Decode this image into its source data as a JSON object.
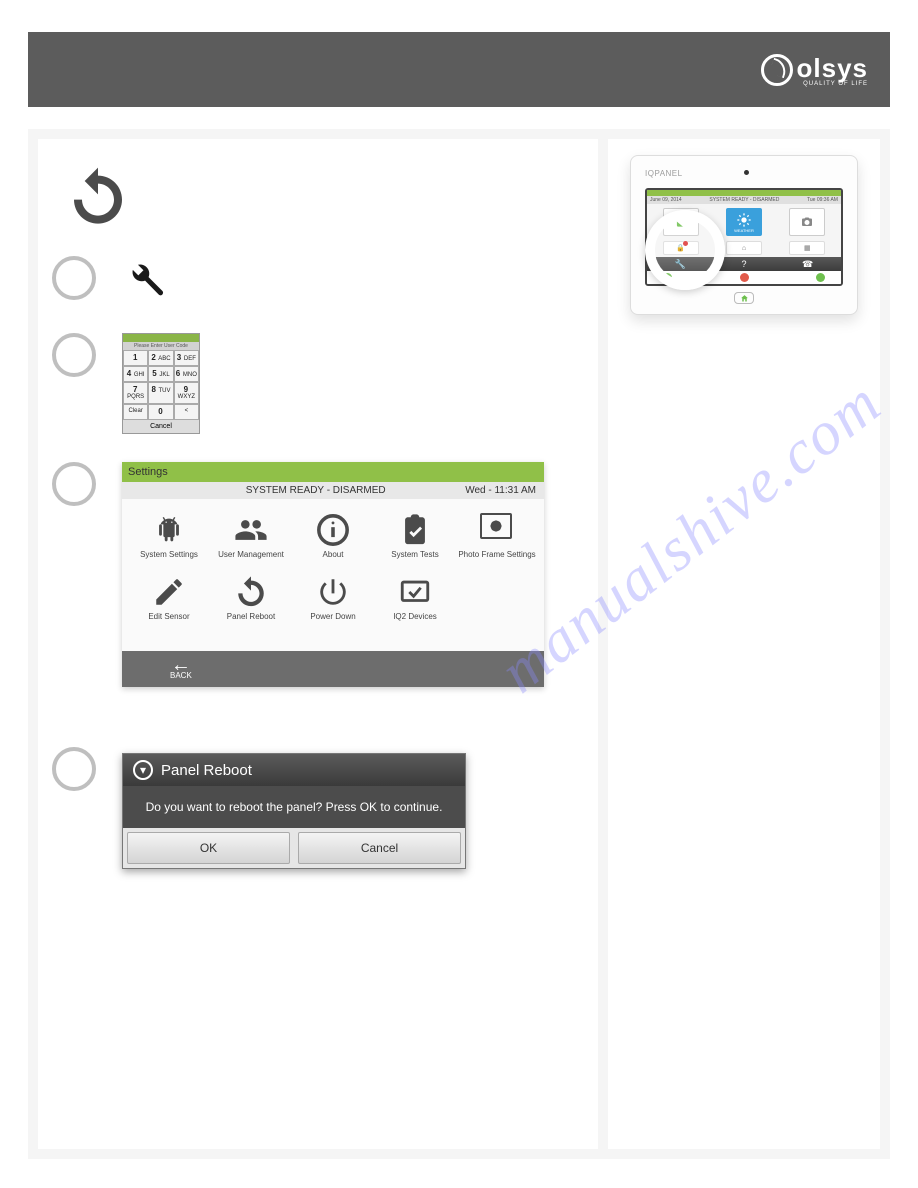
{
  "brand": {
    "name": "olsys",
    "tagline": "QUALITY OF LIFE"
  },
  "keypad": {
    "title": "Please Enter User Code",
    "keys": [
      "1",
      "2 ABC",
      "3 DEF",
      "4 GHI",
      "5 JKL",
      "6 MNO",
      "7 PQRS",
      "8 TUV",
      "9 WXYZ",
      "Clear",
      "0",
      "<"
    ],
    "cancel": "Cancel"
  },
  "settings": {
    "header_left": "Settings",
    "header_center": "SYSTEM READY - DISARMED",
    "header_right": "Wed - 11:31 AM",
    "back": "BACK",
    "items": [
      {
        "label": "System Settings"
      },
      {
        "label": "User Management"
      },
      {
        "label": "About"
      },
      {
        "label": "System Tests"
      },
      {
        "label": "Photo Frame Settings"
      },
      {
        "label": "Edit Sensor"
      },
      {
        "label": "Panel Reboot"
      },
      {
        "label": "Power Down"
      },
      {
        "label": "IQ2 Devices"
      }
    ]
  },
  "dialog": {
    "title": "Panel Reboot",
    "message": "Do you want to reboot the panel? Press OK to continue.",
    "ok": "OK",
    "cancel": "Cancel"
  },
  "device": {
    "brand": "IQ",
    "brand_sub": "PANEL",
    "status_left": "June 09, 2014",
    "status_center": "SYSTEM READY - DISARMED",
    "status_right": "Tue   09:36 AM",
    "tiles": {
      "security": "SECURITY",
      "weather": "WEATHER",
      "camera": "CAMERA/VIDEO"
    },
    "bar": {
      "wrench": "wrench-icon",
      "help": "?",
      "phone": "phone-icon"
    }
  },
  "watermark": "manualshive.com"
}
